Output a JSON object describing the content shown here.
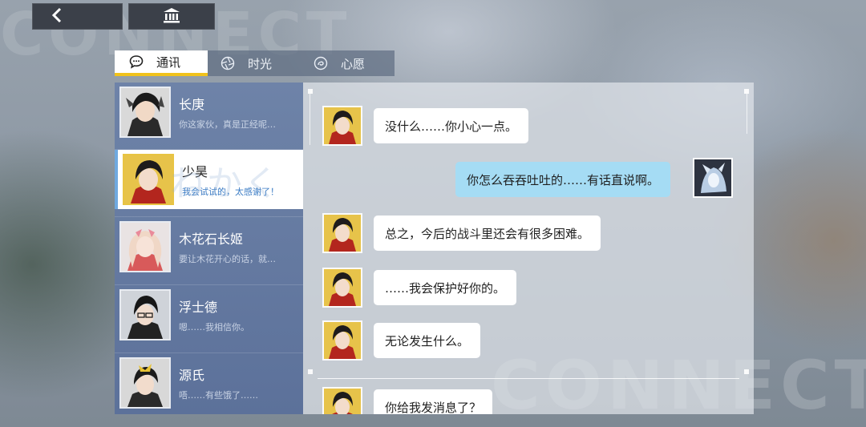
{
  "watermark": {
    "top": "CONNECT",
    "bottom": "CONNECT"
  },
  "nav": {
    "back_icon": "chevron-left-icon",
    "home_icon": "bank-icon"
  },
  "tabs": [
    {
      "label": "通讯",
      "icon": "speech-bubble-icon",
      "active": true
    },
    {
      "label": "时光",
      "icon": "aperture-icon",
      "active": false
    },
    {
      "label": "心愿",
      "icon": "swirl-icon",
      "active": false
    }
  ],
  "contacts": [
    {
      "name": "长庚",
      "preview": "你这家伙，真是正经呢…",
      "active": false
    },
    {
      "name": "少昊",
      "preview": "我会试试的，太感谢了！",
      "active": true
    },
    {
      "name": "木花石长姬",
      "preview": "要让木花开心的话，就…",
      "active": false
    },
    {
      "name": "浮士德",
      "preview": "嗯……我相信你。",
      "active": false
    },
    {
      "name": "源氏",
      "preview": "唔……有些饿了……",
      "active": false
    }
  ],
  "decoration_kana": "ねかく",
  "messages": [
    {
      "sender": "少昊",
      "side": "left",
      "text": "没什么……你小心一点。"
    },
    {
      "sender": "player",
      "side": "right",
      "text": "你怎么吞吞吐吐的……有话直说啊。"
    },
    {
      "sender": "少昊",
      "side": "left",
      "text": "总之，今后的战斗里还会有很多困难。"
    },
    {
      "sender": "少昊",
      "side": "left",
      "text": "……我会保护好你的。"
    },
    {
      "sender": "少昊",
      "side": "left",
      "text": "无论发生什么。"
    },
    {
      "sender": "少昊",
      "side": "left",
      "text": "你给我发消息了？"
    }
  ],
  "colors": {
    "accent_yellow": "#f1c21b",
    "contact_panel": "#6e83a8",
    "self_bubble": "#a5dcf4",
    "active_highlight": "#6fa9e0"
  }
}
